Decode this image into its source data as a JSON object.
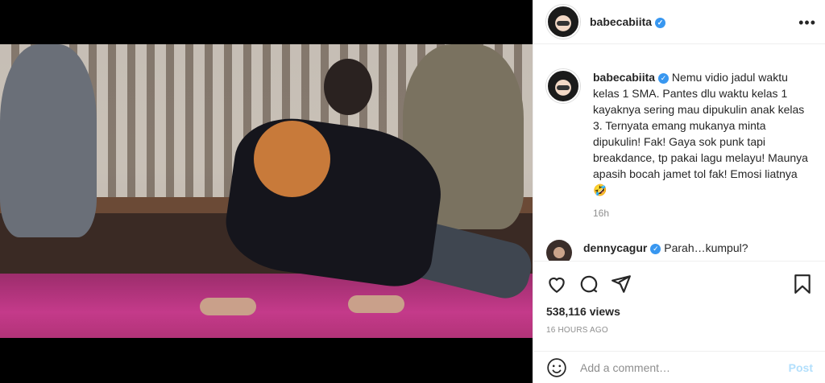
{
  "post": {
    "username": "babecabiita",
    "caption": "Nemu vidio jadul waktu kelas 1 SMA. Pantes dlu waktu kelas 1 kayaknya sering mau dipukulin anak kelas 3. Ternyata emang mukanya minta dipukulin! Fak! Gaya sok punk tapi breakdance, tp pakai lagu melayu! Maunya apasih bocah jamet tol fak! Emosi liatnya 🤣",
    "caption_time": "16h",
    "views": "538,116 views",
    "posted_ago": "16 HOURS AGO"
  },
  "next_comment": {
    "username": "dennycagur",
    "text": "Parah…kumpul?"
  },
  "comment_box": {
    "placeholder": "Add a comment…",
    "post_label": "Post"
  },
  "colors": {
    "verified": "#3897f0",
    "post_disabled": "#b2dffc",
    "muted": "#8e8e8e"
  },
  "icons": [
    "more-options-icon",
    "verified-badge-icon",
    "sound-icon",
    "heart-icon",
    "comment-icon",
    "share-icon",
    "bookmark-icon",
    "emoji-icon"
  ]
}
